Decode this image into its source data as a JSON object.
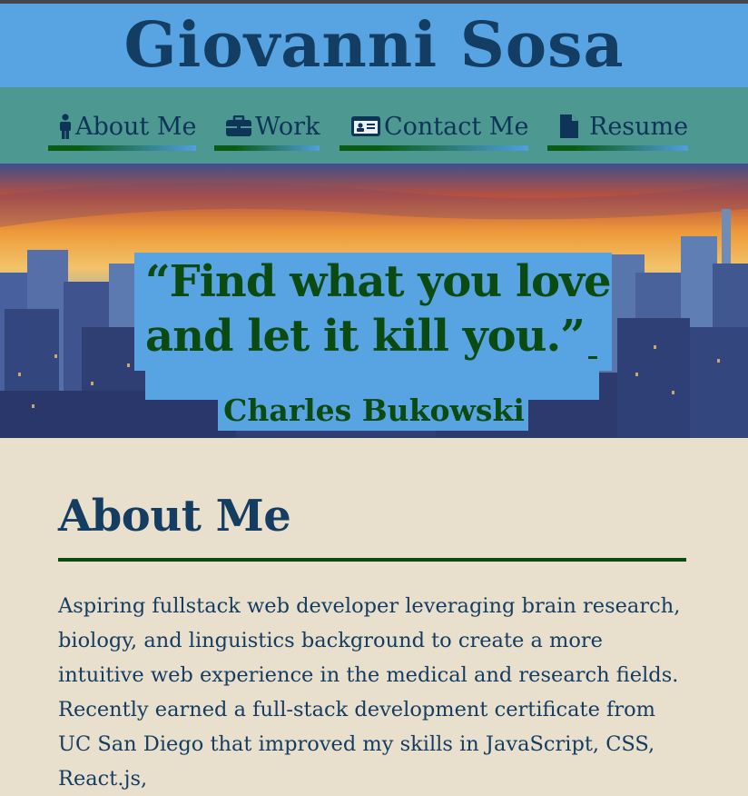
{
  "site": {
    "title": "Giovanni Sosa"
  },
  "nav": {
    "items": [
      {
        "label": "About Me",
        "icon": "person-icon"
      },
      {
        "label": "Work",
        "icon": "briefcase-icon"
      },
      {
        "label": "Contact Me",
        "icon": "id-card-icon"
      },
      {
        "label": "Resume",
        "icon": "file-icon"
      }
    ]
  },
  "hero": {
    "quote_line1": "“Find what you love",
    "quote_line2": "and let it kill you.”",
    "author": "Charles Bukowski"
  },
  "about": {
    "heading": "About Me",
    "body": "Aspiring fullstack web developer leveraging brain research, biology, and linguistics background to create a more intuitive web experience in the medical and research fields. Recently earned a full-stack development certificate from UC San Diego that improved my skills in JavaScript, CSS, React.js,"
  },
  "colors": {
    "header_bg": "#58a4e2",
    "nav_bg": "#4d9891",
    "title_text": "#143d63",
    "quote_text": "#0b4a10",
    "page_bg": "#e8dfcd"
  }
}
